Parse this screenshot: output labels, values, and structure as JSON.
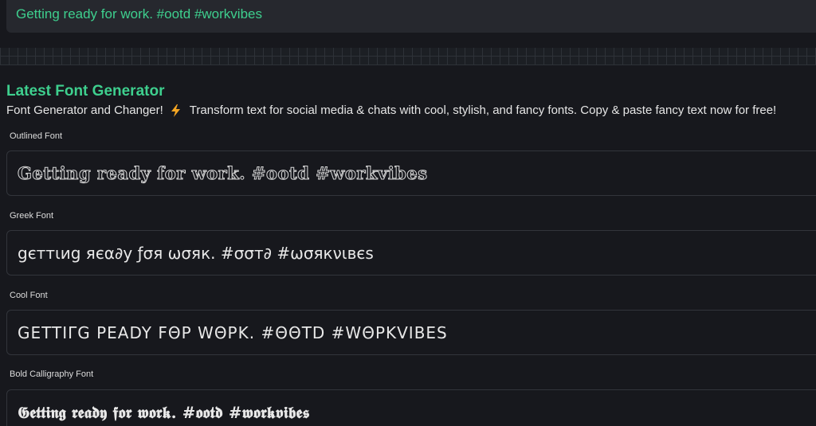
{
  "input": {
    "value": "Getting ready for work. #ootd #workvibes"
  },
  "header": {
    "title": "Latest Font Generator",
    "subtitle_before": "Font Generator and Changer!",
    "subtitle_after": "Transform text for social media & chats with cool, stylish, and fancy fonts. Copy & paste fancy text now for free!"
  },
  "icons": {
    "bolt": "lightning-bolt-icon",
    "bolt_color": "#f5a623"
  },
  "colors": {
    "accent": "#3ecf8e",
    "background": "#17181d",
    "card_border": "#32353b"
  },
  "fonts": [
    {
      "label": "Outlined Font",
      "sample": "Getting ready for work. #ootd #workvibes"
    },
    {
      "label": "Greek Font",
      "sample": "gєттιиg яєα∂у ƒσя ωσяк. #σσт∂ #ωσякνιвєѕ"
    },
    {
      "label": "Cool Font",
      "sample": "GETTIΓG PEADY FΘP WΘPK. #ΘΘTD #WΘPKVIBES"
    },
    {
      "label": "Bold Calligraphy Font",
      "sample": "𝕲𝖊𝖙𝖙𝖎𝖓𝖌 𝖗𝖊𝖆𝖉𝖞 𝖋𝖔𝖗 𝖜𝖔𝖗𝖐. #𝖔𝖔𝖙𝖉 #𝖜𝖔𝖗𝖐𝖛𝖎𝖇𝖊𝖘"
    }
  ]
}
